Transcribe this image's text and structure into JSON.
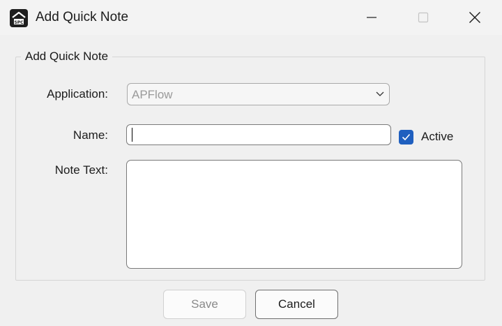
{
  "window": {
    "title": "Add Quick Note",
    "controls": {
      "minimize_icon": "minimize-icon",
      "maximize_icon": "maximize-icon",
      "close_icon": "close-icon"
    },
    "app_icon": "spc-house-logo-icon"
  },
  "group": {
    "title": "Add Quick Note"
  },
  "form": {
    "application": {
      "label": "Application:",
      "value": "APFlow"
    },
    "name": {
      "label": "Name:",
      "value": ""
    },
    "active": {
      "label": "Active",
      "checked": true
    },
    "note_text": {
      "label": "Note Text:",
      "value": ""
    }
  },
  "buttons": {
    "save": "Save",
    "cancel": "Cancel"
  },
  "colors": {
    "accent": "#1f5fbf",
    "window_bg": "#f0f0f0",
    "disabled_text": "#9a9a9a"
  }
}
